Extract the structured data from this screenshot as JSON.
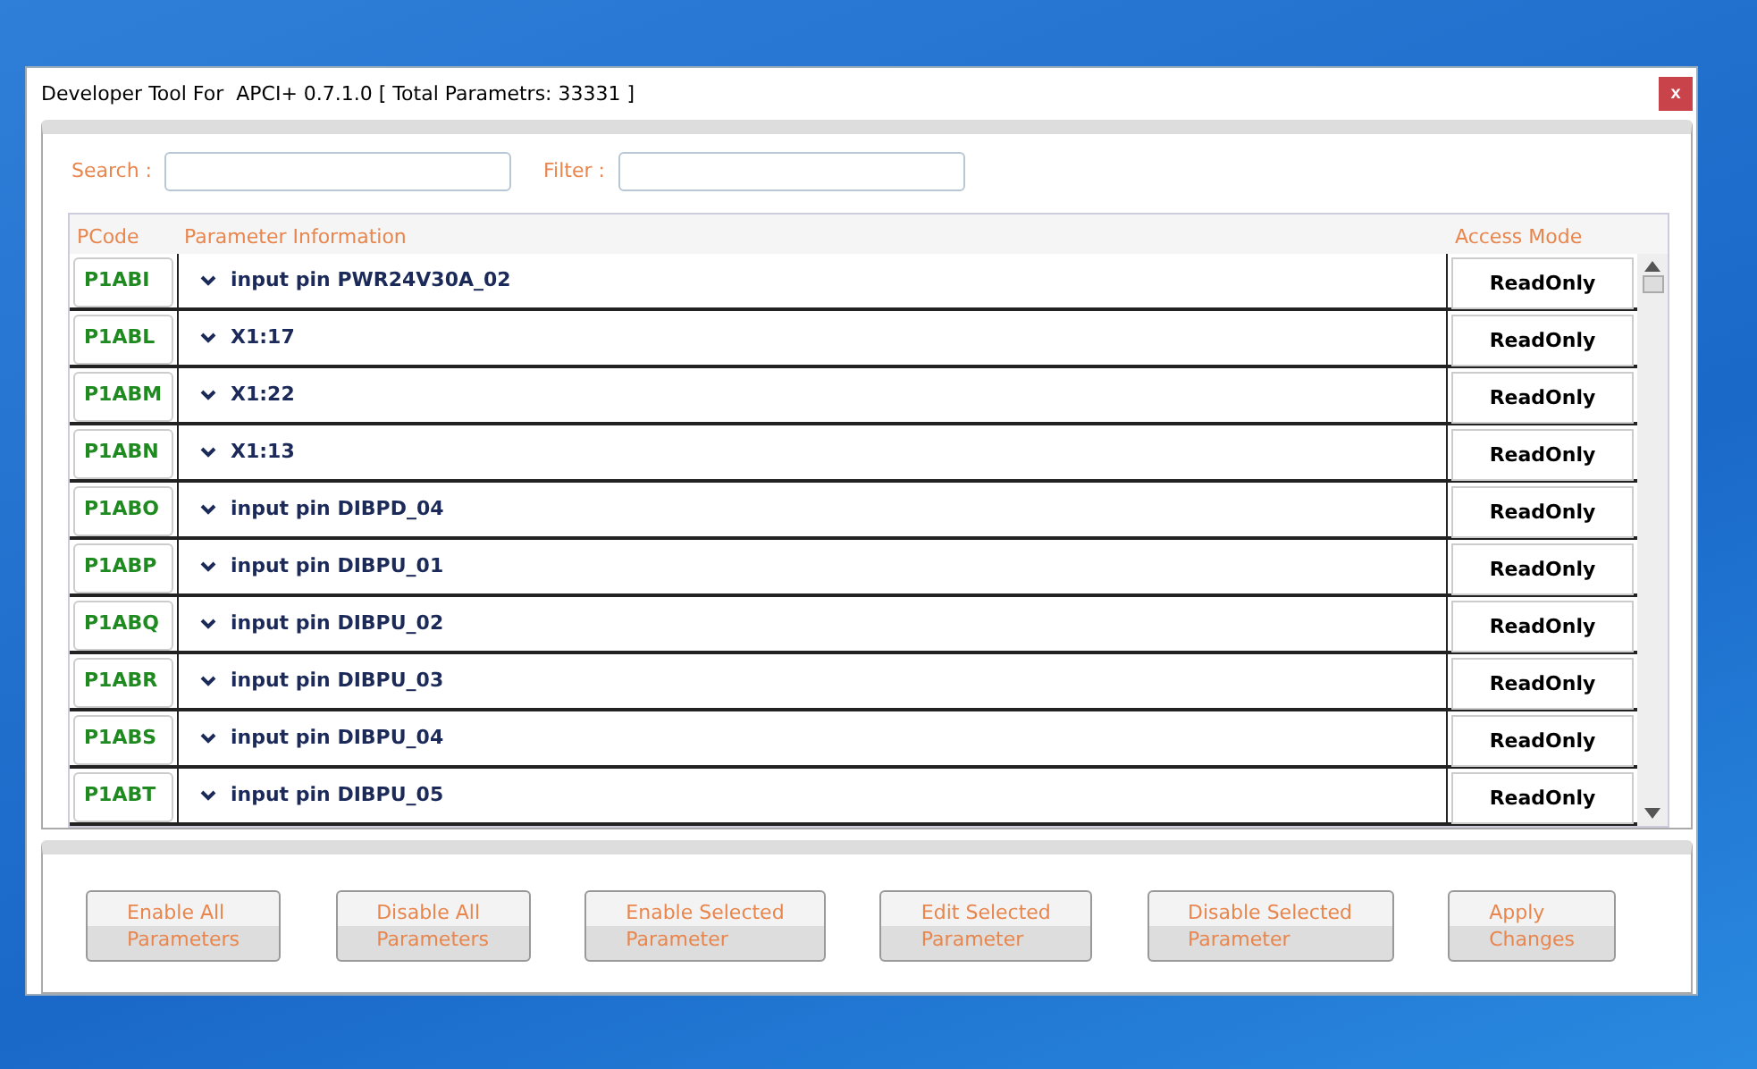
{
  "window": {
    "title": "Developer Tool For  APCI+ 0.7.1.0 [ Total Parametrs: 33331 ]",
    "close": "x"
  },
  "search": {
    "label": "Search :"
  },
  "filter": {
    "label": "Filter :"
  },
  "table": {
    "columns": [
      "PCode",
      "Parameter Information",
      "Access Mode"
    ],
    "rows": [
      {
        "pcode": "P1ABI",
        "info": "input pin PWR24V30A_02",
        "access": "ReadOnly"
      },
      {
        "pcode": "P1ABL",
        "info": "X1:17",
        "access": "ReadOnly"
      },
      {
        "pcode": "P1ABM",
        "info": "X1:22",
        "access": "ReadOnly"
      },
      {
        "pcode": "P1ABN",
        "info": "X1:13",
        "access": "ReadOnly"
      },
      {
        "pcode": "P1ABO",
        "info": "input pin DIBPD_04",
        "access": "ReadOnly"
      },
      {
        "pcode": "P1ABP",
        "info": "input pin DIBPU_01",
        "access": "ReadOnly"
      },
      {
        "pcode": "P1ABQ",
        "info": "input pin DIBPU_02",
        "access": "ReadOnly"
      },
      {
        "pcode": "P1ABR",
        "info": "input pin DIBPU_03",
        "access": "ReadOnly"
      },
      {
        "pcode": "P1ABS",
        "info": "input pin DIBPU_04",
        "access": "ReadOnly"
      },
      {
        "pcode": "P1ABT",
        "info": "input pin DIBPU_05",
        "access": "ReadOnly"
      }
    ]
  },
  "buttons": [
    [
      "Enable All",
      "Parameters"
    ],
    [
      "Disable All",
      "Parameters"
    ],
    [
      "Enable Selected",
      "Parameter"
    ],
    [
      "Edit Selected",
      "Parameter"
    ],
    [
      "Disable Selected",
      "Parameter"
    ],
    [
      "Apply",
      "Changes"
    ]
  ]
}
